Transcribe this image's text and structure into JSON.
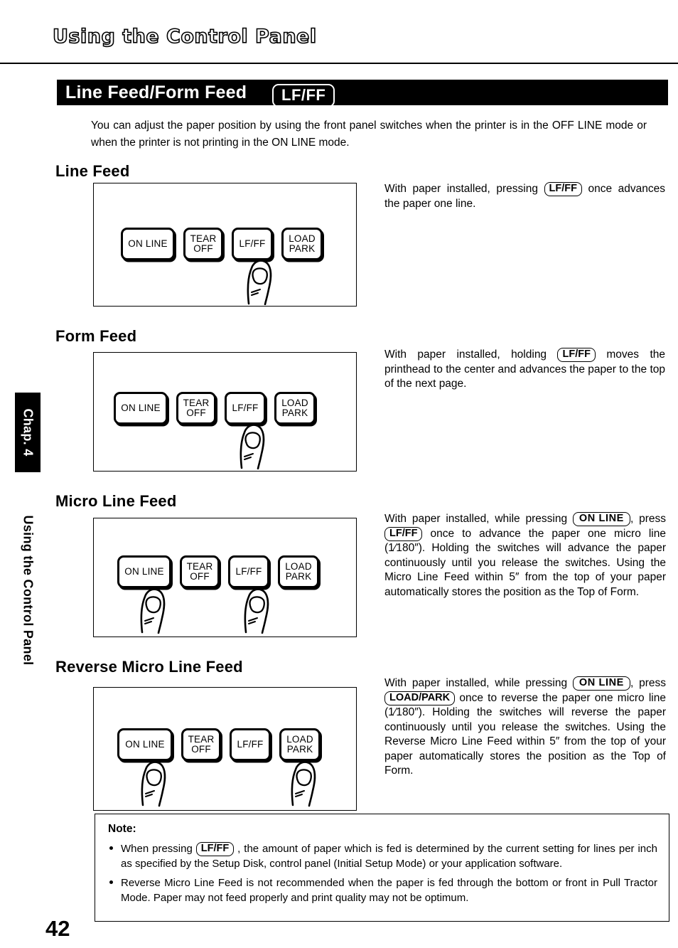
{
  "chapter": {
    "title": "Using the Control Panel",
    "tab_label": "Chap. 4",
    "side_label": "Using the Control Panel",
    "page_number": "42"
  },
  "section": {
    "title": "Line Feed/Form Feed",
    "badge": "LF/FF"
  },
  "intro": "You can adjust the paper position by using the front panel switches when the printer is in the OFF LINE mode or when the printer is not printing in the ON LINE mode.",
  "panel_buttons": {
    "on_line": "ON LINE",
    "tear_off_l1": "TEAR",
    "tear_off_l2": "OFF",
    "lf_ff": "LF/FF",
    "load_l1": "LOAD",
    "load_l2": "PARK"
  },
  "keys": {
    "lf_ff": "LF/FF",
    "on_line": "ON LINE",
    "load_park": "LOAD/PARK"
  },
  "sections": [
    {
      "heading": "Line Feed",
      "pressed": [
        "LF/FF"
      ],
      "text_a": "With paper installed, pressing",
      "text_b": "once advances the paper one line."
    },
    {
      "heading": "Form Feed",
      "pressed": [
        "LF/FF"
      ],
      "text_a": "With paper installed, holding",
      "text_b": "moves the printhead to the center and advances the paper to the top of the next page."
    },
    {
      "heading": "Micro Line Feed",
      "pressed": [
        "ON LINE",
        "LF/FF"
      ],
      "text_a": "With paper installed, while pressing",
      "text_b": ",",
      "text_c": "press",
      "text_d": "once to advance the paper one micro line (1⁄180″). Holding the switches will advance the paper continuously until you release the switches. Using the Micro Line Feed within 5″ from the top of your paper automatically stores the position as the Top of Form.",
      "frac_num": "1⁄",
      "frac_den": "180",
      "frac_unit": "”"
    },
    {
      "heading": "Reverse Micro Line Feed",
      "pressed": [
        "ON LINE",
        "LOAD PARK"
      ],
      "text_a": "With paper installed, while pressing",
      "text_b": ",",
      "text_c": "press",
      "text_d": "once to reverse the paper one micro line (1⁄180″). Holding the switches will reverse the paper continuously until you release the switches. Using the Reverse Micro Line Feed within 5″ from the top of your paper automatically stores the position as the Top of Form."
    }
  ],
  "note": {
    "title": "Note:",
    "items": [
      {
        "pre": "When pressing",
        "key": "LF/FF",
        "post": ", the amount of paper which is fed is determined by the current setting for lines per inch as specified by the Setup Disk, control panel (Initial Setup Mode) or your application software."
      },
      {
        "pre": "",
        "key": "",
        "post": "Reverse Micro Line Feed is not recommended when the paper is fed through the bottom or front in Pull Tractor Mode. Paper may not feed properly and print quality may not be optimum."
      }
    ]
  },
  "colors": {
    "ink": "#000000",
    "paper": "#ffffff"
  }
}
